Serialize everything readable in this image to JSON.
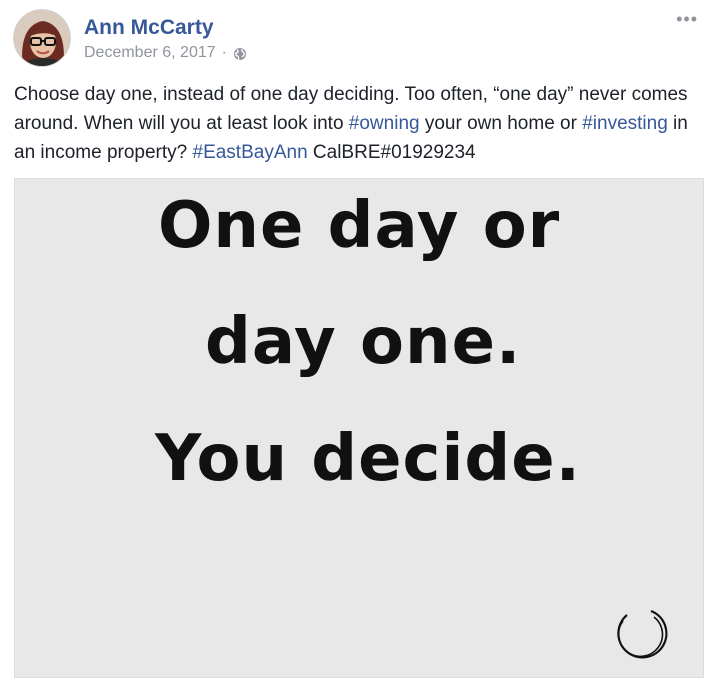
{
  "post": {
    "author": "Ann McCarty",
    "date": "December 6, 2017",
    "separator": "·",
    "privacy_icon": "globe-icon",
    "more_icon": "more-options-icon",
    "more_glyph": "•••",
    "text_segments": [
      {
        "text": "Choose day one, instead of one day deciding. Too often, “one day” never comes around. When will you at least look into ",
        "link": false
      },
      {
        "text": "#owning",
        "link": true
      },
      {
        "text": " your own home or ",
        "link": false
      },
      {
        "text": "#investing",
        "link": true
      },
      {
        "text": " in an income property? ",
        "link": false
      },
      {
        "text": "#EastBayAnn",
        "link": true
      },
      {
        "text": " CalBRE#01929234",
        "link": false
      }
    ]
  },
  "image": {
    "lines": [
      "One day or",
      "day one.",
      "You decide."
    ],
    "logo_icon": "circle-logo-icon"
  },
  "colors": {
    "link": "#365899",
    "meta": "#90949c",
    "text": "#1d2129",
    "image_bg": "#e8e8e8"
  }
}
